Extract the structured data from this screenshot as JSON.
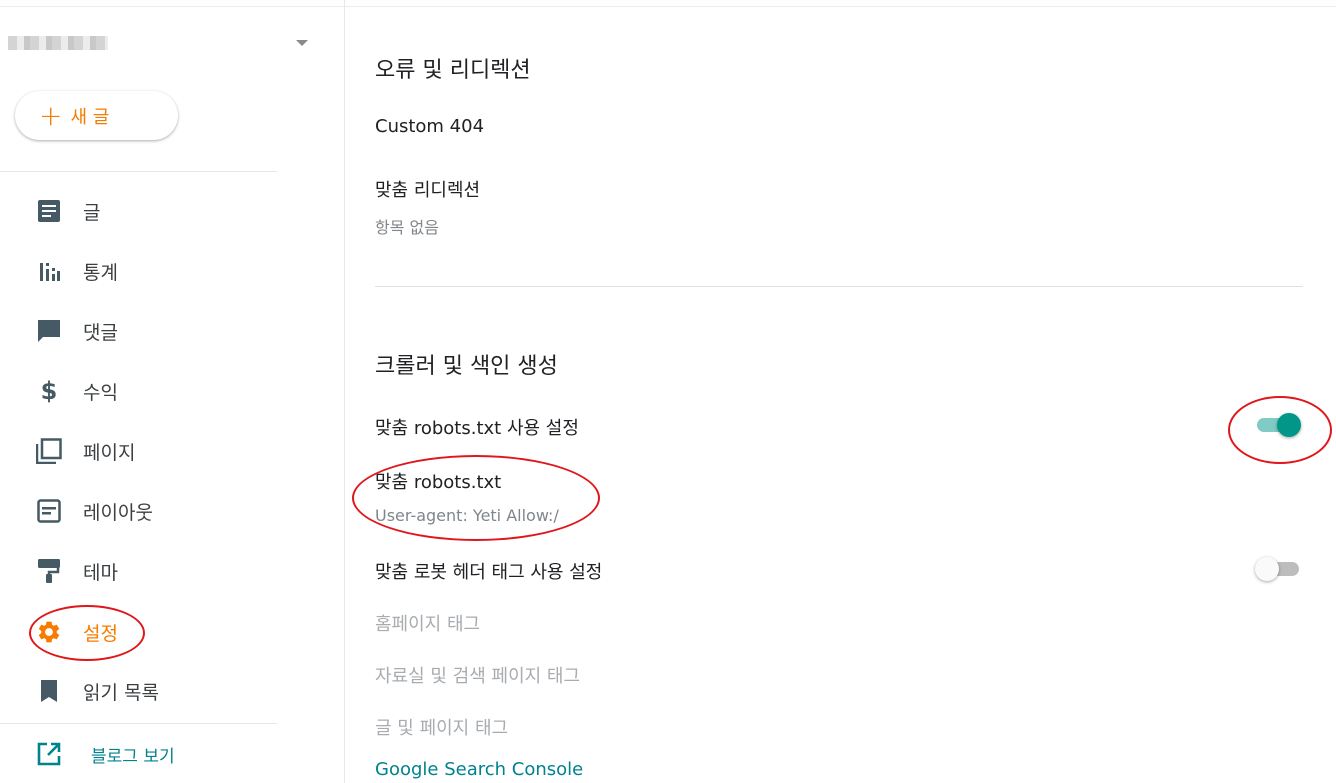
{
  "sidebar": {
    "new_post_label": "새 글",
    "items": [
      {
        "label": "글",
        "icon": "posts-icon"
      },
      {
        "label": "통계",
        "icon": "stats-icon"
      },
      {
        "label": "댓글",
        "icon": "comments-icon"
      },
      {
        "label": "수익",
        "icon": "dollar-icon"
      },
      {
        "label": "페이지",
        "icon": "pages-icon"
      },
      {
        "label": "레이아웃",
        "icon": "layout-icon"
      },
      {
        "label": "테마",
        "icon": "theme-icon"
      },
      {
        "label": "설정",
        "icon": "gear-icon",
        "active": true
      },
      {
        "label": "읽기 목록",
        "icon": "bookmark-icon"
      }
    ],
    "view_blog_label": "블로그 보기"
  },
  "errors_section": {
    "title": "오류 및 리디렉션",
    "custom_404_label": "Custom 404",
    "custom_redirects_label": "맞춤 리디렉션",
    "custom_redirects_value": "항목 없음"
  },
  "crawlers_section": {
    "title": "크롤러 및 색인 생성",
    "enable_robots_label": "맞춤 robots.txt 사용 설정",
    "enable_robots_on": true,
    "robots_label": "맞춤 robots.txt",
    "robots_value": "User-agent: Yeti Allow:/",
    "enable_header_tags_label": "맞춤 로봇 헤더 태그 사용 설정",
    "enable_header_tags_on": false,
    "homepage_tags_label": "홈페이지 태그",
    "archive_search_tags_label": "자료실 및 검색 페이지 태그",
    "post_page_tags_label": "글 및 페이지 태그",
    "search_console_label": "Google Search Console"
  },
  "colors": {
    "accent": "#f57c00",
    "toggle_on": "#009688",
    "link": "#00838f",
    "annotation": "#e0161b"
  }
}
